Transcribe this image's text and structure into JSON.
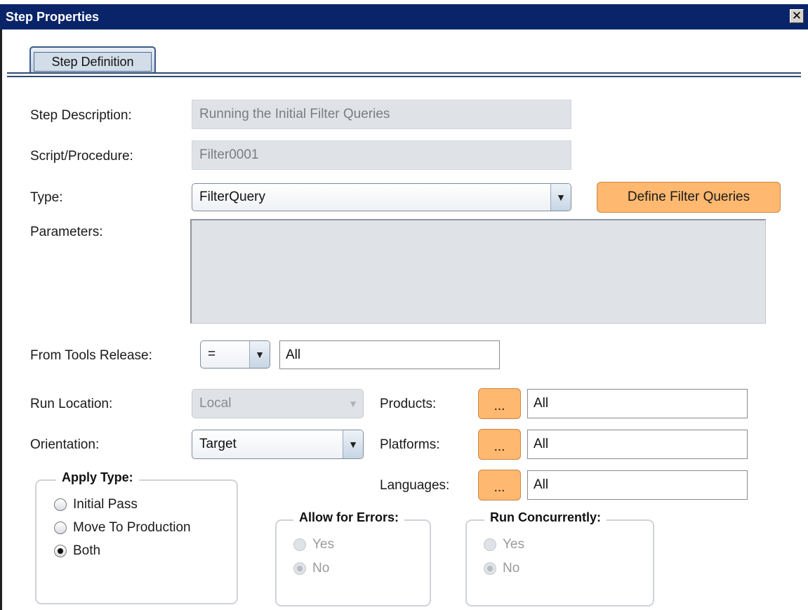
{
  "window": {
    "title": "Step Properties",
    "close_glyph": "✕"
  },
  "tabs": [
    {
      "label": "Step Definition"
    }
  ],
  "labels": {
    "step_description": "Step Description:",
    "script_procedure": "Script/Procedure:",
    "type": "Type:",
    "parameters": "Parameters:",
    "from_tools_release": "From Tools Release:",
    "run_location": "Run Location:",
    "orientation": "Orientation:",
    "products": "Products:",
    "platforms": "Platforms:",
    "languages": "Languages:"
  },
  "fields": {
    "step_description": "Running the Initial Filter Queries",
    "script_procedure": "Filter0001",
    "type": "FilterQuery",
    "parameters": "",
    "tools_release_operator": "=",
    "tools_release_value": "All",
    "run_location": "Local",
    "orientation": "Target",
    "products": "All",
    "platforms": "All",
    "languages": "All"
  },
  "buttons": {
    "define_filter_queries": "Define Filter Queries",
    "ellipsis": "..."
  },
  "apply_type": {
    "title": "Apply Type:",
    "options": [
      "Initial Pass",
      "Move To Production",
      "Both"
    ],
    "selected": "Both"
  },
  "allow_for_errors": {
    "title": "Allow for Errors:",
    "options": [
      "Yes",
      "No"
    ],
    "selected": "No",
    "enabled": false
  },
  "run_concurrently": {
    "title": "Run Concurrently:",
    "options": [
      "Yes",
      "No"
    ],
    "selected": "No",
    "enabled": false
  },
  "icons": {
    "dropdown": "▼"
  },
  "colors": {
    "titlebar": "#0a246a",
    "accent_button": "#ffb870",
    "disabled_field": "#dfe3e8"
  }
}
